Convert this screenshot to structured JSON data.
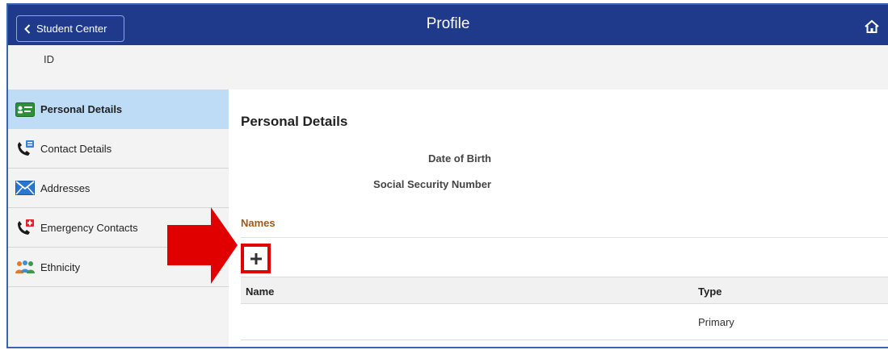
{
  "header": {
    "back_label": "Student Center",
    "title": "Profile"
  },
  "id_row": {
    "label": "ID"
  },
  "sidebar": {
    "items": [
      {
        "label": "Personal Details",
        "icon": "personal-card-icon",
        "active": true
      },
      {
        "label": "Contact Details",
        "icon": "phone-contact-icon",
        "active": false
      },
      {
        "label": "Addresses",
        "icon": "envelope-icon",
        "active": false
      },
      {
        "label": "Emergency Contacts",
        "icon": "emergency-phone-icon",
        "active": false
      },
      {
        "label": "Ethnicity",
        "icon": "people-icon",
        "active": false
      }
    ]
  },
  "main": {
    "section_title": "Personal Details",
    "fields": {
      "dob_label": "Date of Birth",
      "ssn_label": "Social Security Number"
    },
    "names": {
      "heading": "Names",
      "add_symbol": "+",
      "columns": [
        "Name",
        "Type"
      ],
      "rows": [
        {
          "name": "",
          "type": "Primary"
        }
      ]
    }
  },
  "colors": {
    "header_bg": "#1f3a8a",
    "active_nav": "#bfdcf7",
    "names_heading": "#9c5a1a",
    "highlight": "#e00000"
  }
}
